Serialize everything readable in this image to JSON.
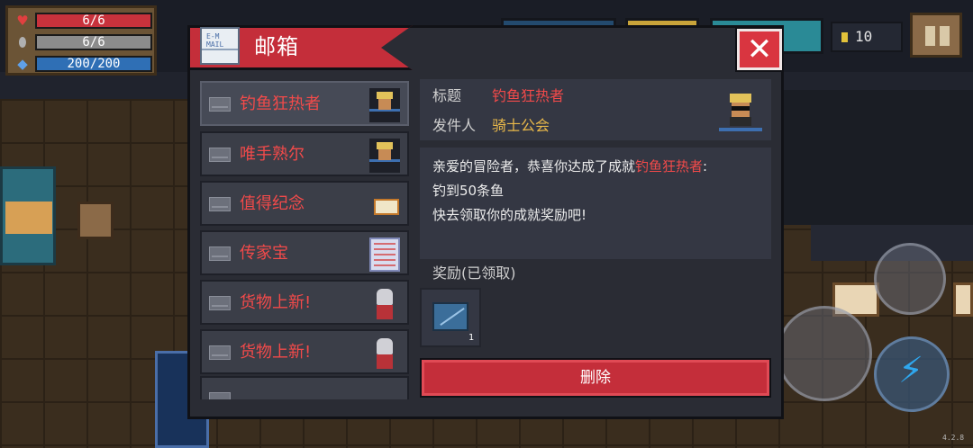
{
  "hud": {
    "hp": "6/6",
    "armor": "6/6",
    "energy": "200/200",
    "coins": "10",
    "version": "4.2.8"
  },
  "mailbox": {
    "title": "邮箱",
    "mail_list": [
      {
        "label": "钓鱼狂热者",
        "thumb": "fisherman-icon",
        "selected": true
      },
      {
        "label": "唯手熟尔",
        "thumb": "fisherman-icon",
        "selected": false
      },
      {
        "label": "值得纪念",
        "thumb": "letter-icon",
        "selected": false
      },
      {
        "label": "传家宝",
        "thumb": "document-icon",
        "selected": false
      },
      {
        "label": "货物上新!",
        "thumb": "knight-icon",
        "selected": false
      },
      {
        "label": "货物上新!",
        "thumb": "knight-icon",
        "selected": false
      }
    ],
    "detail": {
      "subject_label": "标题",
      "subject": "钓鱼狂热者",
      "sender_label": "发件人",
      "sender": "骑士公会",
      "body_line1_prefix": "亲爱的冒险者，恭喜你达成了成就",
      "body_line1_highlight": "钓鱼狂热者",
      "body_line1_suffix": ":",
      "body_line2": "钓到50条鱼",
      "body_line3": "快去领取你的成就奖励吧!",
      "reward_label": "奖励(已领取)",
      "reward_count": "1",
      "delete_label": "删除"
    }
  },
  "colors": {
    "accent_red": "#c42e3a",
    "highlight_text": "#f24a4a",
    "hp_bar": "#c8323c",
    "armor_bar": "#8c8c8c",
    "energy_bar": "#2f6fb5"
  }
}
